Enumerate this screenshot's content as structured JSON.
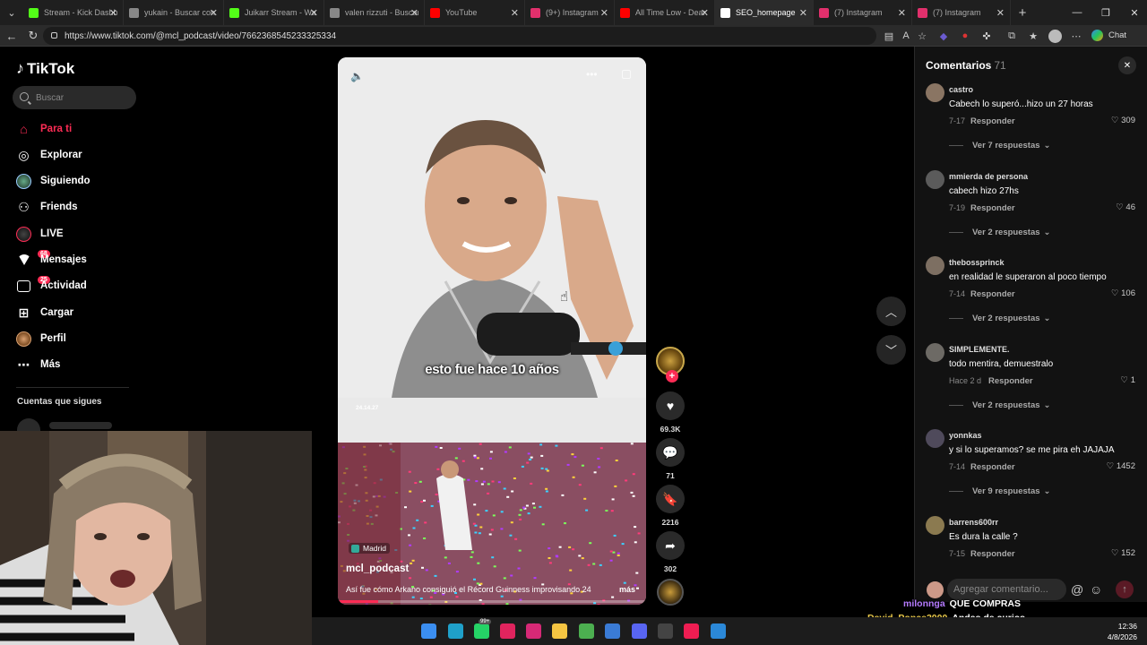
{
  "browser": {
    "tabs": [
      {
        "title": "Stream - Kick Dashb",
        "fav": "#53fc18"
      },
      {
        "title": "yukain - Buscar con",
        "fav": "#888888"
      },
      {
        "title": "Juikarr Stream - Wa",
        "fav": "#53fc18"
      },
      {
        "title": "valen rizzuti - Buscar",
        "fav": "#888888"
      },
      {
        "title": "YouTube",
        "fav": "#ff0000"
      },
      {
        "title": "(9+) Instagram",
        "fav": "#e1306c"
      },
      {
        "title": "All Time Low - Dear",
        "fav": "#ff0000"
      },
      {
        "title": "SEO_homepage",
        "fav": "#ffffff"
      },
      {
        "title": "(7) Instagram",
        "fav": "#e1306c"
      },
      {
        "title": "(7) Instagram",
        "fav": "#e1306c"
      }
    ],
    "url": "https://www.tiktok.com/@mcl_podcast/video/7662368545233325334",
    "chat_label": "Chat"
  },
  "sidebar": {
    "logo": "TikTok",
    "search_placeholder": "Buscar",
    "items": [
      {
        "label": "Para ti",
        "icon": "home-icon"
      },
      {
        "label": "Explorar",
        "icon": "compass-icon"
      },
      {
        "label": "Siguiendo",
        "icon": "following-avatar-icon"
      },
      {
        "label": "Friends",
        "icon": "friends-icon"
      },
      {
        "label": "LIVE",
        "icon": "live-icon"
      },
      {
        "label": "Mensajes",
        "icon": "messages-icon",
        "badge": "68"
      },
      {
        "label": "Actividad",
        "icon": "activity-icon",
        "badge": "25"
      },
      {
        "label": "Cargar",
        "icon": "upload-icon"
      },
      {
        "label": "Perfil",
        "icon": "profile-icon"
      },
      {
        "label": "Más",
        "icon": "more-icon"
      }
    ],
    "following_header": "Cuentas que sigues"
  },
  "video": {
    "caption_overlay": "esto fue hace 10 años",
    "inner_date": "24.14.27",
    "location": "Madrid",
    "username": "mcl_podcast",
    "description": "Así fue cómo Arkano consiguió el Récord Guinness improvisando 24",
    "more_label": "más",
    "progress": 0.13
  },
  "actions": {
    "likes": "69.3K",
    "comments": "71",
    "saves": "2216",
    "shares": "302"
  },
  "comments_panel": {
    "title": "Comentarios",
    "count": "71",
    "reply_label": "Responder",
    "items": [
      {
        "user": "castro",
        "text": "Cabech lo superó...hizo un 27 horas",
        "date": "7-17",
        "likes": "309",
        "more": "Ver 7 respuestas"
      },
      {
        "user": "mmierda de persona",
        "text": "cabech hizo 27hs",
        "date": "7-19",
        "likes": "46",
        "more": "Ver 2 respuestas"
      },
      {
        "user": "thebossprinck",
        "text": "en realidad le superaron al poco tiempo",
        "date": "7-14",
        "likes": "106",
        "more": "Ver 2 respuestas"
      },
      {
        "user": "SIMPLEMENTE.",
        "text": "todo mentira, demuestralo",
        "date": "Hace 2 d",
        "likes": "1",
        "more": "Ver 2 respuestas"
      },
      {
        "user": "yonnkas",
        "text": "y si lo superamos? se me pira eh JAJAJA",
        "date": "7-14",
        "likes": "1452",
        "more": "Ver 9 respuestas"
      },
      {
        "user": "barrens600rr",
        "text": "Es dura la calle ?",
        "date": "7-15",
        "likes": "152",
        "more": ""
      }
    ],
    "input_placeholder": "Agregar comentario..."
  },
  "stream_chat": [
    {
      "user": "milonnga",
      "msg": "QUE COMPRAS",
      "color": "#b57bff"
    },
    {
      "user": "David_Ponce2000",
      "msg": "Andas de curios",
      "color": "#e8c84a"
    },
    {
      "user": "David_Ponce2000",
      "msg": "😂",
      "color": "#e8c84a"
    }
  ],
  "taskbar": {
    "time": "12:36",
    "date": "4/8/2026",
    "badge": "99+"
  }
}
